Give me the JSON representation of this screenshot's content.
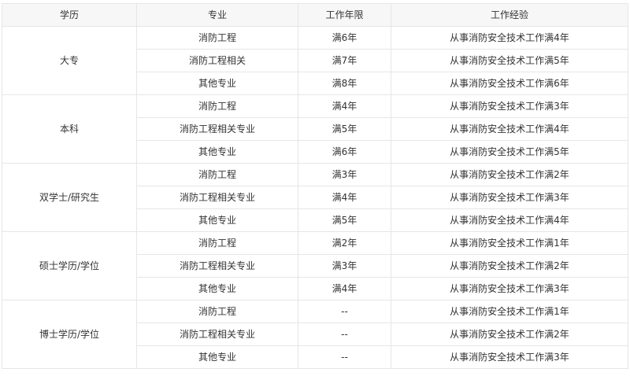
{
  "table": {
    "headers": [
      "学历",
      "专业",
      "工作年限",
      "工作经验"
    ],
    "groups": [
      {
        "education": "大专",
        "rows": [
          {
            "major": "消防工程",
            "years": "满6年",
            "experience": "从事消防安全技术工作满4年"
          },
          {
            "major": "消防工程相关",
            "years": "满7年",
            "experience": "从事消防安全技术工作满5年"
          },
          {
            "major": "其他专业",
            "years": "满8年",
            "experience": "从事消防安全技术工作满6年"
          }
        ]
      },
      {
        "education": "本科",
        "rows": [
          {
            "major": "消防工程",
            "years": "满4年",
            "experience": "从事消防安全技术工作满3年"
          },
          {
            "major": "消防工程相关专业",
            "years": "满5年",
            "experience": "从事消防安全技术工作满4年"
          },
          {
            "major": "其他专业",
            "years": "满6年",
            "experience": "从事消防安全技术工作满5年"
          }
        ]
      },
      {
        "education": "双学士/研究生",
        "rows": [
          {
            "major": "消防工程",
            "years": "满3年",
            "experience": "从事消防安全技术工作满2年"
          },
          {
            "major": "消防工程相关专业",
            "years": "满4年",
            "experience": "从事消防安全技术工作满3年"
          },
          {
            "major": "其他专业",
            "years": "满5年",
            "experience": "从事消防安全技术工作满4年"
          }
        ]
      },
      {
        "education": "硕士学历/学位",
        "rows": [
          {
            "major": "消防工程",
            "years": "满2年",
            "experience": "从事消防安全技术工作满1年"
          },
          {
            "major": "消防工程相关专业",
            "years": "满3年",
            "experience": "从事消防安全技术工作满2年"
          },
          {
            "major": "其他专业",
            "years": "满4年",
            "experience": "从事消防安全技术工作满3年"
          }
        ]
      },
      {
        "education": "博士学历/学位",
        "rows": [
          {
            "major": "消防工程",
            "years": "--",
            "experience": "从事消防安全技术工作满1年"
          },
          {
            "major": "消防工程相关专业",
            "years": "--",
            "experience": "从事消防安全技术工作满2年"
          },
          {
            "major": "其他专业",
            "years": "--",
            "experience": "从事消防安全技术工作满3年"
          }
        ]
      }
    ]
  }
}
